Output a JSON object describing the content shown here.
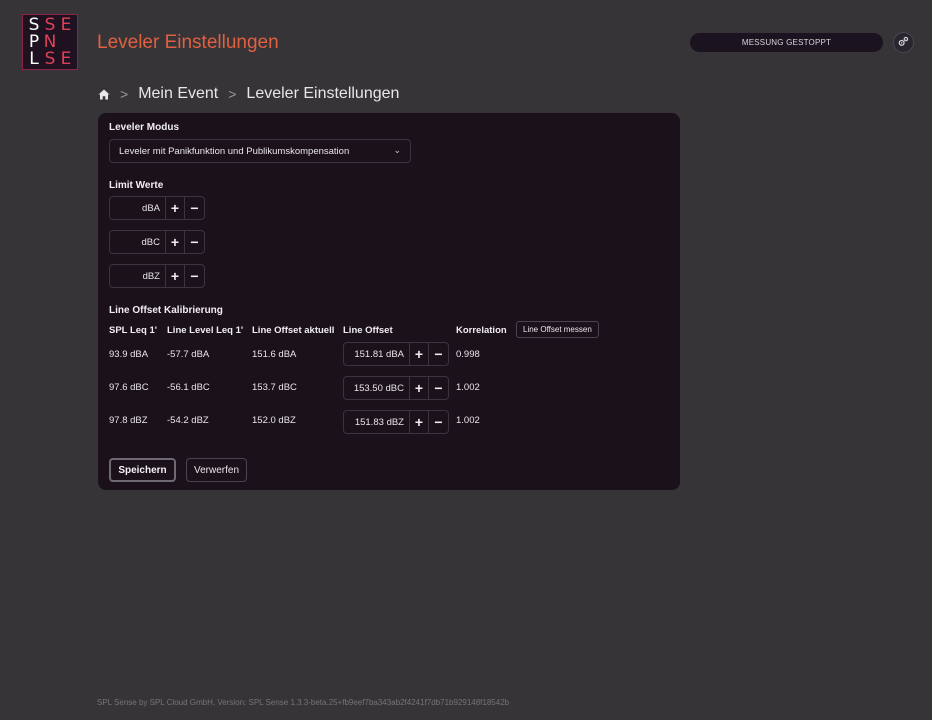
{
  "logo": {
    "letters": [
      {
        "ch": "S",
        "color": "white"
      },
      {
        "ch": "S",
        "color": "pink"
      },
      {
        "ch": "E",
        "color": "pink"
      },
      {
        "ch": "P",
        "color": "white"
      },
      {
        "ch": "N",
        "color": "pink"
      },
      {
        "ch": "",
        "color": "pink"
      },
      {
        "ch": "L",
        "color": "white"
      },
      {
        "ch": "S",
        "color": "pink"
      },
      {
        "ch": "E",
        "color": "pink"
      }
    ]
  },
  "header": {
    "title": "Leveler Einstellungen",
    "status": "MESSUNG GESTOPPT"
  },
  "breadcrumb": {
    "items": [
      "Mein Event",
      "Leveler Einstellungen"
    ],
    "separator": ">"
  },
  "form": {
    "mode_label": "Leveler Modus",
    "mode_value": "Leveler mit Panikfunktion und Publikumskompensation",
    "limit_label": "Limit Werte",
    "limits": [
      {
        "value": "",
        "unit": "dBA"
      },
      {
        "value": "",
        "unit": "dBC"
      },
      {
        "value": "",
        "unit": "dBZ"
      }
    ],
    "plus": "+",
    "minus": "−",
    "calibration_label": "Line Offset Kalibrierung",
    "columns": {
      "spl": "SPL Leq 1'",
      "line_level": "Line Level Leq 1'",
      "offset_current": "Line Offset aktuell",
      "offset": "Line Offset",
      "correlation": "Korrelation"
    },
    "measure_button": "Line Offset messen",
    "rows": [
      {
        "spl": "93.9 dBA",
        "line_level": "-57.7 dBA",
        "offset_current": "151.6 dBA",
        "offset_value": "151.81",
        "offset_unit": "dBA",
        "correlation": "0.998"
      },
      {
        "spl": "97.6 dBC",
        "line_level": "-56.1 dBC",
        "offset_current": "153.7 dBC",
        "offset_value": "153.50",
        "offset_unit": "dBC",
        "correlation": "1.002"
      },
      {
        "spl": "97.8 dBZ",
        "line_level": "-54.2 dBZ",
        "offset_current": "152.0 dBZ",
        "offset_value": "151.83",
        "offset_unit": "dBZ",
        "correlation": "1.002"
      }
    ],
    "save_label": "Speichern",
    "discard_label": "Verwerfen"
  },
  "footer": {
    "text": "SPL Sense by SPL Cloud GmbH, Version: SPL Sense 1.3.3-beta.25+fb9eef7ba343ab2f4241f7db71b929148f18542b"
  },
  "colors": {
    "background": "#363437",
    "card": "#1b111b",
    "title": "#e06040",
    "logo_accent": "#e0405a"
  }
}
